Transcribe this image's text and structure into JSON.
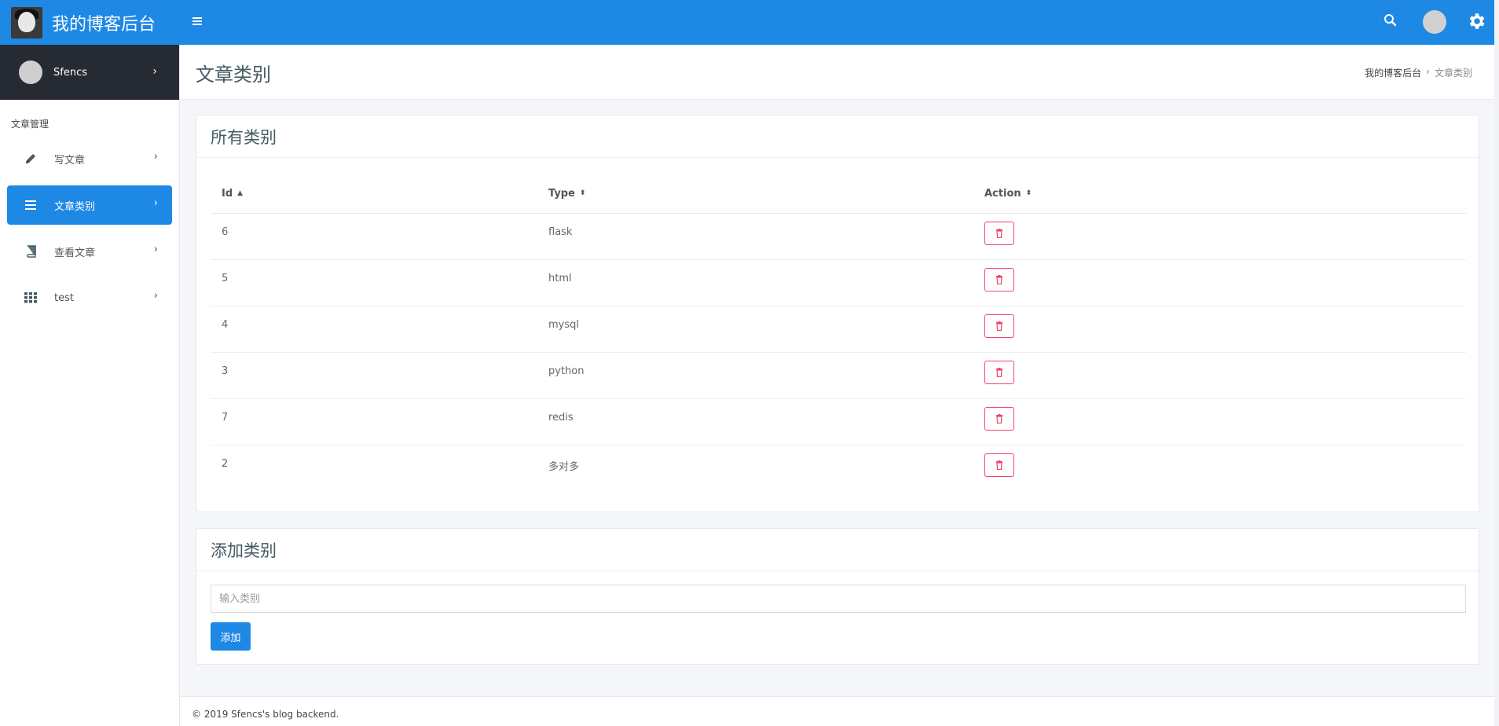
{
  "brand": {
    "title": "我的博客后台"
  },
  "user": {
    "name": "Sfencs"
  },
  "sidebar": {
    "heading": "文章管理",
    "items": [
      {
        "label": "写文章",
        "icon": "pencil-icon",
        "active": false
      },
      {
        "label": "文章类别",
        "icon": "list-icon",
        "active": true
      },
      {
        "label": "查看文章",
        "icon": "book-icon",
        "active": false
      },
      {
        "label": "test",
        "icon": "grid-icon",
        "active": false
      }
    ]
  },
  "page": {
    "title": "文章类别",
    "breadcrumb": {
      "home": "我的博客后台",
      "current": "文章类别"
    }
  },
  "categories_card": {
    "title": "所有类别",
    "columns": [
      "Id",
      "Type",
      "Action"
    ],
    "rows": [
      {
        "id": "6",
        "type": "flask"
      },
      {
        "id": "5",
        "type": "html"
      },
      {
        "id": "4",
        "type": "mysql"
      },
      {
        "id": "3",
        "type": "python"
      },
      {
        "id": "7",
        "type": "redis"
      },
      {
        "id": "2",
        "type": "多对多"
      }
    ]
  },
  "add_card": {
    "title": "添加类别",
    "input_placeholder": "输入类别",
    "input_value": "",
    "button_label": "添加"
  },
  "footer": {
    "text": "© 2019 Sfencs's blog backend."
  },
  "colors": {
    "primary": "#1e88e5",
    "danger": "#f2446e",
    "sidebar_dark": "#262b33"
  }
}
